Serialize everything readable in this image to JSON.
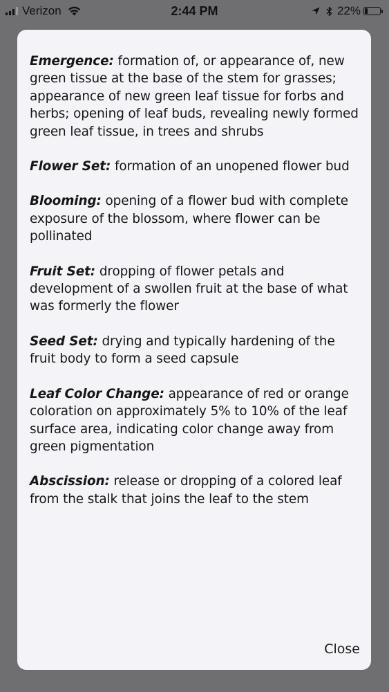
{
  "status_bar": {
    "carrier": "Verizon",
    "time": "2:44 PM",
    "battery_percent": "22%",
    "battery_level": 0.22,
    "signal_bars_filled": 3,
    "signal_bars_total": 4,
    "icons": [
      "signal-icon",
      "wifi-icon",
      "location-arrow-icon",
      "bluetooth-icon",
      "battery-icon"
    ]
  },
  "modal": {
    "terms": [
      {
        "name": "Emergence:",
        "definition": "formation of, or appearance of, new green tissue at the base of the stem for grasses; appearance of new green leaf tissue for forbs and herbs; opening of leaf buds, revealing newly formed green leaf tissue, in trees and shrubs"
      },
      {
        "name": "Flower Set:",
        "definition": "formation of an unopened flower bud"
      },
      {
        "name": "Blooming:",
        "definition": "opening of a flower bud with complete exposure of the blossom, where flower can be pollinated"
      },
      {
        "name": "Fruit Set:",
        "definition": "dropping of flower petals and development of a swollen fruit at the base of what was formerly the flower"
      },
      {
        "name": "Seed Set:",
        "definition": "drying and typically hardening of the fruit body to form a seed capsule"
      },
      {
        "name": "Leaf Color Change:",
        "definition": "appearance of red or orange coloration on approximately 5% to 10% of the leaf surface area, indicating color change away from green pigmentation"
      },
      {
        "name": "Abscission:",
        "definition": "release or dropping of a colored leaf from the stalk that joins the leaf to the stem"
      }
    ],
    "close_label": "Close"
  },
  "colors": {
    "backdrop": "#6f6f71",
    "modal_background": "#f4f3f8",
    "text": "#161616"
  }
}
